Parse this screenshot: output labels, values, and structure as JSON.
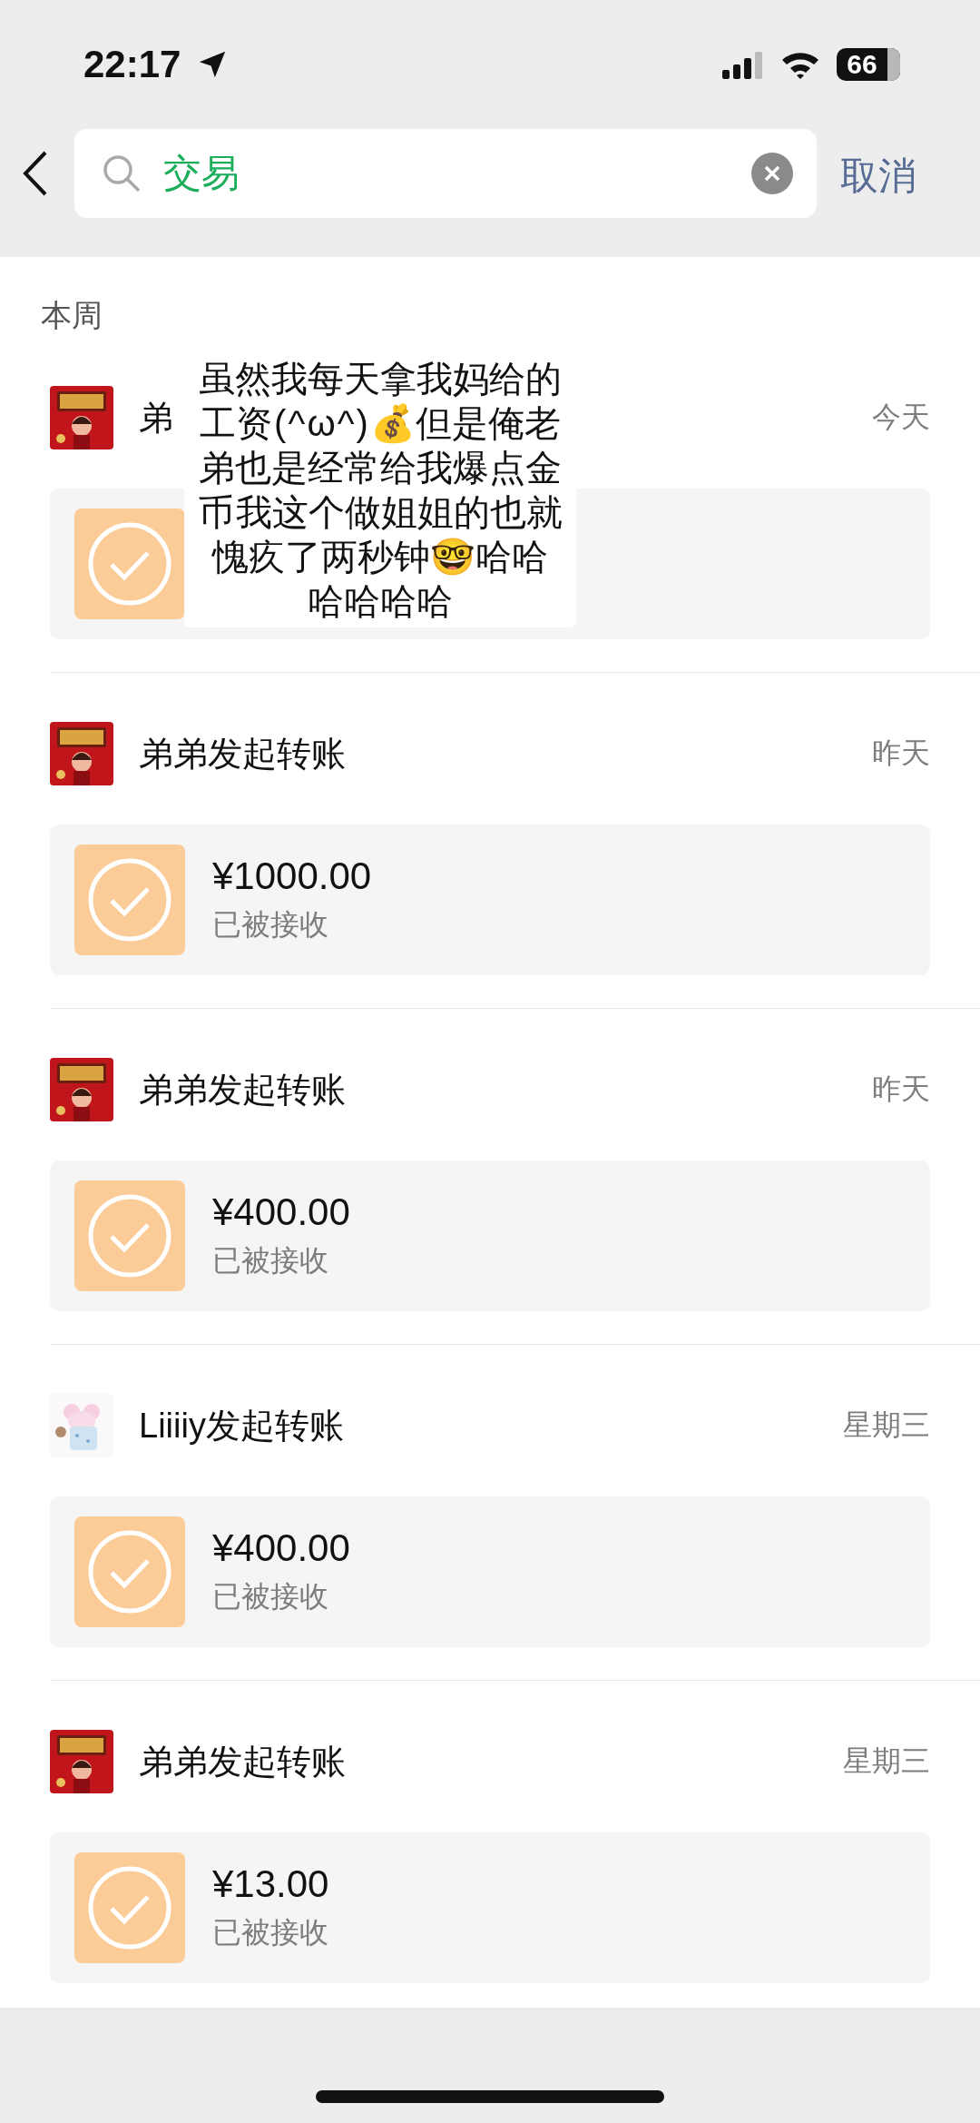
{
  "status_bar": {
    "time": "22:17",
    "battery": "66"
  },
  "search": {
    "value": "交易",
    "cancel": "取消"
  },
  "section": "本周",
  "transfers": [
    {
      "kind": "festive",
      "title": "弟",
      "date": "今天"
    },
    {
      "kind": "festive",
      "title": "弟弟发起转账",
      "date": "昨天",
      "amount": "¥1000.00",
      "status": "已被接收"
    },
    {
      "kind": "festive",
      "title": "弟弟发起转账",
      "date": "昨天",
      "amount": "¥400.00",
      "status": "已被接收"
    },
    {
      "kind": "mouse",
      "title": "Liiiiy发起转账",
      "date": "星期三",
      "amount": "¥400.00",
      "status": "已被接收"
    },
    {
      "kind": "festive",
      "title": "弟弟发起转账",
      "date": "星期三",
      "amount": "¥13.00",
      "status": "已被接收"
    }
  ],
  "caption": "虽然我每天拿我妈给的工资 ( ^ ω ^ ) 💰但是俺老弟也是经常给我爆点金币 我这个做姐姐的也就愧疚了两秒钟🤓哈哈哈哈哈哈"
}
